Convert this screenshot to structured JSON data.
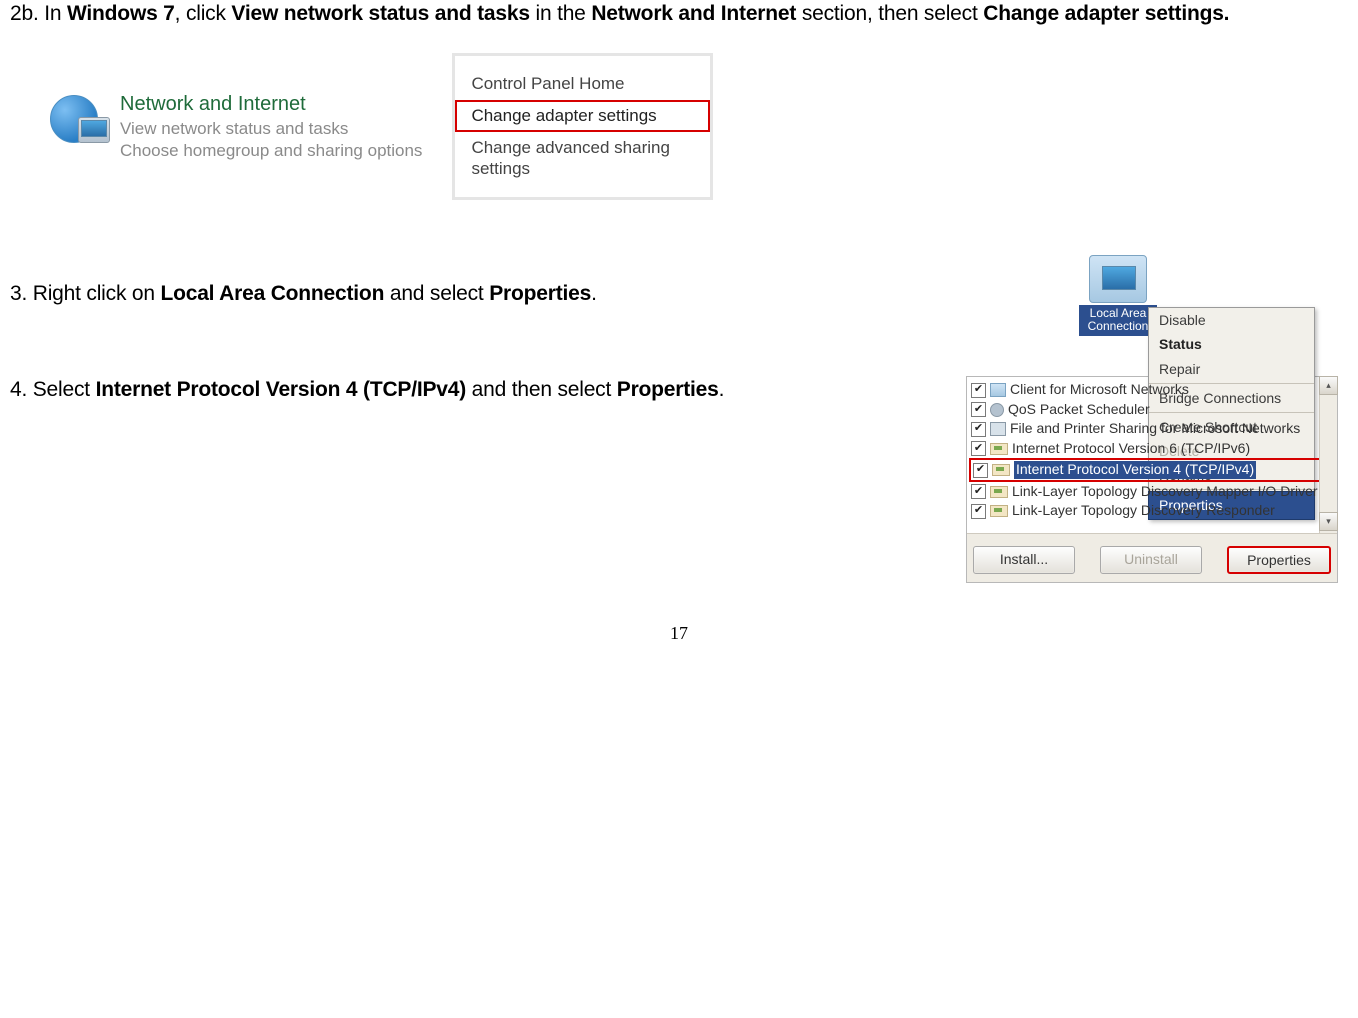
{
  "step2b": {
    "prefix": "2b.   In ",
    "os": "Windows 7",
    "mid1": ", click ",
    "action1": "View network status and tasks",
    "mid2": " in the ",
    "section": "Network and Internet",
    "mid3": " section, then select ",
    "action2": "Change adapter settings."
  },
  "netInternet": {
    "title": "Network and Internet",
    "link1": "View network status and tasks",
    "link2": "Choose homegroup and sharing options"
  },
  "cpNav": {
    "item1": "Control Panel Home",
    "item2": "Change adapter settings",
    "item3": "Change advanced sharing settings"
  },
  "step3": {
    "prefix": "3. Right click on ",
    "target": "Local Area Connection",
    "mid": " and select ",
    "action": "Properties",
    "suffix": "."
  },
  "lac": {
    "label": "Local Area Connection"
  },
  "ctxMenu": {
    "disable": "Disable",
    "status": "Status",
    "repair": "Repair",
    "bridge": "Bridge Connections",
    "shortcut": "Create Shortcut",
    "delete": "Delete",
    "rename": "Rename",
    "properties": "Properties"
  },
  "step4": {
    "prefix": "4. Select ",
    "target": "Internet Protocol Version 4 (TCP/IPv4)",
    "mid": " and then select ",
    "action": "Properties",
    "suffix": "."
  },
  "propsList": {
    "items": [
      "Client for Microsoft Networks",
      "QoS Packet Scheduler",
      "File and Printer Sharing for Microsoft Networks",
      "Internet Protocol Version 6 (TCP/IPv6)",
      "Internet Protocol Version 4 (TCP/IPv4)",
      "Link-Layer Topology Discovery Mapper I/O Driver",
      "Link-Layer Topology Discovery Responder"
    ],
    "install": "Install...",
    "uninstall": "Uninstall",
    "properties": "Properties"
  },
  "pageNumber": "17"
}
